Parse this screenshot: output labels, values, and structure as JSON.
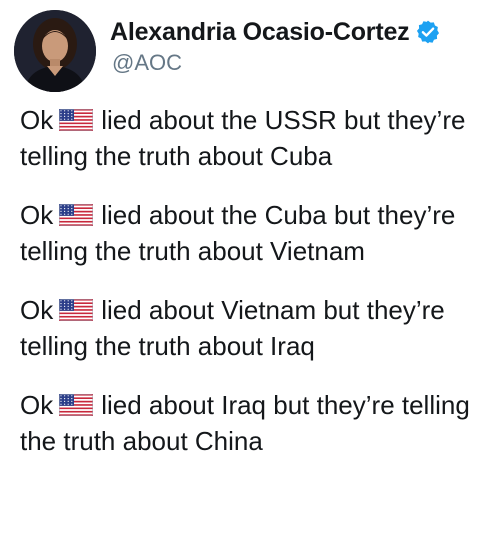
{
  "user": {
    "display_name": "Alexandria Ocasio-Cortez",
    "handle": "@AOC",
    "verified": true,
    "avatar_icon": "profile-photo",
    "verified_icon": "verified-badge-icon",
    "verified_color": "#1da1f2"
  },
  "tweet": {
    "flag_icon": "us-flag-emoji",
    "paragraphs": [
      {
        "prefix": "Ok",
        "text": "lied about the USSR but they’re telling the truth about Cuba"
      },
      {
        "prefix": "Ok",
        "text": "lied about the Cuba but they’re telling the truth about Vietnam"
      },
      {
        "prefix": "Ok",
        "text": "lied about Vietnam but they’re telling the truth about Iraq"
      },
      {
        "prefix": "Ok",
        "text": "lied about Iraq but they’re telling the truth about China"
      }
    ]
  },
  "colors": {
    "text": "#14171a",
    "secondary_text": "#657786",
    "background": "#ffffff"
  }
}
